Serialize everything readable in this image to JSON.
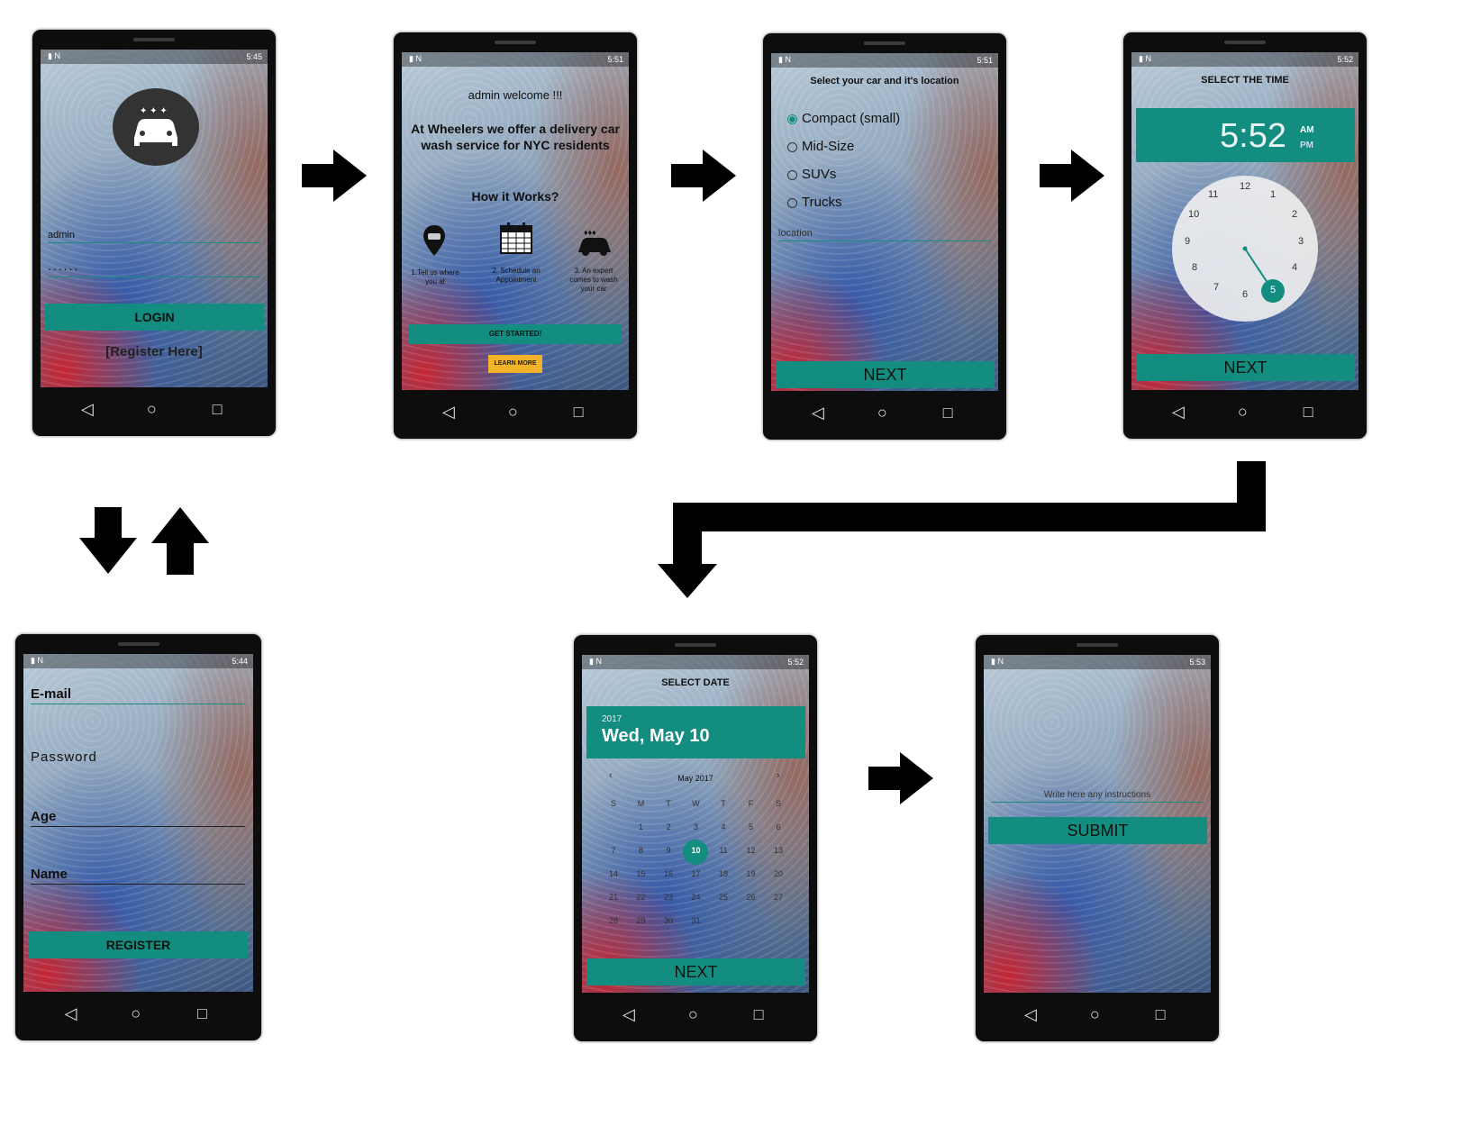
{
  "phone_login": {
    "time": "5:45",
    "username": "admin",
    "password_mask": "......",
    "login_label": "LOGIN",
    "register_link": "[Register Here]",
    "logo_icon": "car-sparkle-icon"
  },
  "phone_welcome": {
    "time": "5:51",
    "greeting": "admin welcome !!!",
    "tagline": "At Wheelers we offer a delivery car wash service for NYC residents",
    "how_title": "How it Works?",
    "steps": [
      {
        "icon": "location-car-icon",
        "label": "1.Tell us where you at"
      },
      {
        "icon": "calendar-icon",
        "label": "2. Schedule an Appointment"
      },
      {
        "icon": "car-wash-icon",
        "label": "3. An expert comes to wash your car"
      }
    ],
    "get_started_label": "GET STARTED!",
    "learn_more_label": "LEARN MORE"
  },
  "phone_car": {
    "time": "5:51",
    "title": "Select your car and it's location",
    "options": [
      "Compact (small)",
      "Mid-Size",
      "SUVs",
      "Trucks"
    ],
    "selected_index": 0,
    "location_placeholder": "location",
    "next_label": "NEXT"
  },
  "phone_time": {
    "time": "5:52",
    "title": "SELECT THE TIME",
    "clock_time": "5:52",
    "am": "AM",
    "pm": "PM",
    "dial_numbers": [
      "12",
      "1",
      "2",
      "3",
      "4",
      "5",
      "6",
      "7",
      "8",
      "9",
      "10",
      "11"
    ],
    "selected_hour": "5",
    "next_label": "NEXT"
  },
  "phone_register": {
    "time": "5:44",
    "email_label": "E-mail",
    "password_label": "Password",
    "age_label": "Age",
    "name_label": "Name",
    "register_label": "REGISTER"
  },
  "phone_date": {
    "time": "5:52",
    "title": "SELECT DATE",
    "year": "2017",
    "date_text": "Wed, May 10",
    "month_label": "May 2017",
    "weekdays": [
      "S",
      "M",
      "T",
      "W",
      "T",
      "F",
      "S"
    ],
    "weeks": [
      [
        "",
        "1",
        "2",
        "3",
        "4",
        "5",
        "6"
      ],
      [
        "7",
        "8",
        "9",
        "10",
        "11",
        "12",
        "13"
      ],
      [
        "14",
        "15",
        "16",
        "17",
        "18",
        "19",
        "20"
      ],
      [
        "21",
        "22",
        "23",
        "24",
        "25",
        "26",
        "27"
      ],
      [
        "28",
        "29",
        "30",
        "31",
        "",
        "",
        ""
      ]
    ],
    "selected_day": "10",
    "next_label": "NEXT"
  },
  "phone_submit": {
    "time": "5:53",
    "instructions_placeholder": "Write here any instructions",
    "submit_label": "SUBMIT"
  },
  "colors": {
    "accent": "#128d7f",
    "learn_more": "#f2b32a",
    "arrow": "#000000"
  }
}
